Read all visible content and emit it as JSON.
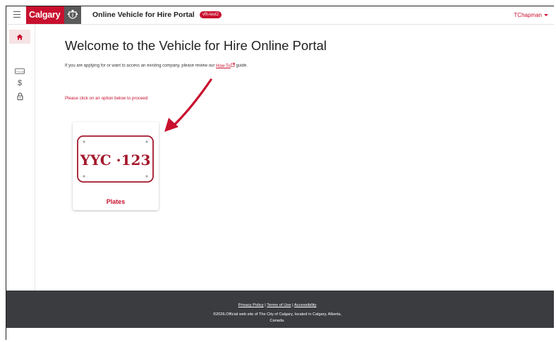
{
  "header": {
    "logo_text": "Calgary",
    "portal_title": "Online Vehicle for Hire Portal",
    "env_badge": "vfh-test2",
    "user_name": "TChapman"
  },
  "sidebar": {
    "items": [
      {
        "name": "home",
        "icon": "home-icon",
        "active": true
      },
      {
        "name": "plates",
        "icon": "plate-icon",
        "label": "YYC 123"
      },
      {
        "name": "payments",
        "icon": "dollar-icon",
        "label": "$"
      },
      {
        "name": "security",
        "icon": "lock-icon"
      }
    ]
  },
  "main": {
    "title": "Welcome to the Vehicle for Hire Online Portal",
    "intro_before": "If you are applying for or want to access an existing company, please review our ",
    "intro_link": "How-To",
    "intro_after": " guide.",
    "proceed_text": "Please click on an option below to proceed",
    "cards": [
      {
        "plate_text": "YYC ·123",
        "label": "Plates"
      }
    ]
  },
  "footer": {
    "privacy": "Privacy Policy",
    "separator": "|",
    "terms": "Terms of Use",
    "accessibility": "Accessibility",
    "copyright_line1": "©2026.Official web site of The City of Calgary, located in Calgary, Alberta,",
    "copyright_line2": "Canada."
  },
  "colors": {
    "accent": "#c8102e",
    "footer_bg": "#3a3c40",
    "text": "#222222"
  }
}
